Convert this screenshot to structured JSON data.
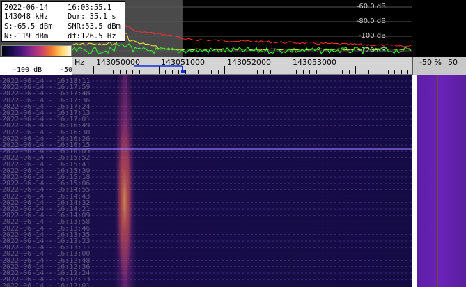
{
  "info": {
    "date": "2022-06-14",
    "time": "16:03:55.1",
    "freq": "143048 kHz",
    "dur": "Dur: 35.1 s",
    "signal": "S:-65.5 dBm",
    "snr": "SNR:53.5 dBm",
    "noise": "N:-119 dBm",
    "df": "df:126.5 Hz"
  },
  "db_scale": {
    "low": "-100 dB",
    "high": "-50"
  },
  "spectrum_db_labels": [
    "-60.0 dB",
    "-80.0 dB",
    "-100 dB",
    "-120 dB"
  ],
  "freq_axis": {
    "unit": "Hz",
    "labels": [
      "143050000",
      "143051000",
      "143052000",
      "143053000"
    ]
  },
  "right_panel": {
    "left_label": "-50 %",
    "right_label": "50"
  },
  "timestamps": [
    "2022-06-14 - 16:18:11",
    "2022-06-14 - 16:17:59",
    "2022-06-14 - 16:17:48",
    "2022-06-14 - 16:17:36",
    "2022-06-14 - 16:17:24",
    "2022-06-14 - 16:17:13",
    "2022-06-14 - 16:17:01",
    "2022-06-14 - 16:16:49",
    "2022-06-14 - 16:16:38",
    "2022-06-14 - 16:16:26",
    "2022-06-14 - 16:16:15",
    "2022-06-14 - 16:16:05",
    "2022-06-14 - 16:15:52",
    "2022-06-14 - 16:15:41",
    "2022-06-14 - 16:15:30",
    "2022-06-14 - 16:15:18",
    "2022-06-14 - 16:15:06",
    "2022-06-14 - 16:14:55",
    "2022-06-14 - 16:14:43",
    "2022-06-14 - 16:14:32",
    "2022-06-14 - 16:14:21",
    "2022-06-14 - 16:14:09",
    "2022-06-14 - 16:13:58",
    "2022-06-14 - 16:13:46",
    "2022-06-14 - 16:13:35",
    "2022-06-14 - 16:13:23",
    "2022-06-14 - 16:13:11",
    "2022-06-14 - 16:13:00",
    "2022-06-14 - 16:12:48",
    "2022-06-14 - 16:12:36",
    "2022-06-14 - 16:12:24",
    "2022-06-14 - 16:12:13",
    "2022-06-14 - 16:12:01"
  ],
  "colors": {
    "trace_max": "#ff3030",
    "trace_avg": "#f0f040",
    "trace_live": "#30ff30",
    "waterfall_bg": "#1a0d4a",
    "signal_hot": "#ffc840",
    "right_panel": "#6420b0"
  }
}
